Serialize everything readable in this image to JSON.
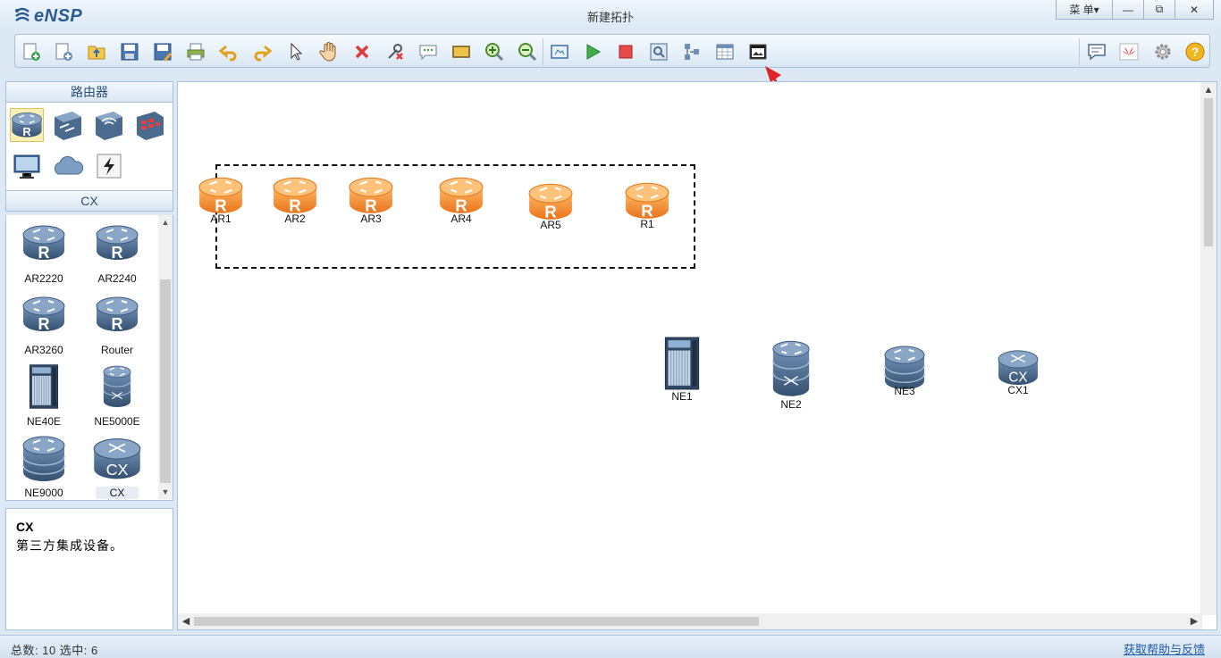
{
  "app": {
    "name": "eNSP",
    "window_title": "新建拓扑"
  },
  "window_controls": {
    "menu": "菜 单▾",
    "minimize": "—",
    "restore": "⧉",
    "close": "✕"
  },
  "toolbar": {
    "icons": [
      "new-topology-icon",
      "new-page-icon",
      "open-icon",
      "save-icon",
      "save-as-icon",
      "print-icon",
      "undo-icon",
      "redo-icon",
      "select-icon",
      "hand-icon",
      "delete-icon",
      "delete-link-icon",
      "text-icon",
      "rectangle-icon",
      "zoom-in-icon",
      "zoom-out-icon",
      "fit-icon",
      "start-icon",
      "stop-icon",
      "capture-icon",
      "topology-icon",
      "grid-icon",
      "console-icon"
    ],
    "right_icons": [
      "message-icon",
      "huawei-icon",
      "settings-icon",
      "help-icon"
    ]
  },
  "sidebar": {
    "category_header": "路由器",
    "categories": [
      "router-category-icon",
      "switch-category-icon",
      "wlan-category-icon",
      "firewall-category-icon",
      "pc-category-icon",
      "cloud-category-icon",
      "link-category-icon"
    ],
    "device_header": "CX",
    "devices": [
      {
        "label": "AR2220",
        "icon": "ar2220-icon"
      },
      {
        "label": "AR2240",
        "icon": "ar2240-icon"
      },
      {
        "label": "AR3260",
        "icon": "ar3260-icon"
      },
      {
        "label": "Router",
        "icon": "router-icon"
      },
      {
        "label": "NE40E",
        "icon": "ne40e-icon"
      },
      {
        "label": "NE5000E",
        "icon": "ne5000e-icon"
      },
      {
        "label": "NE9000",
        "icon": "ne9000-icon"
      },
      {
        "label": "CX",
        "icon": "cx-icon"
      }
    ],
    "info": {
      "title": "CX",
      "description": "第三方集成设备。"
    }
  },
  "canvas": {
    "nodes": [
      {
        "label": "AR1",
        "kind": "orange-router"
      },
      {
        "label": "AR2",
        "kind": "orange-router"
      },
      {
        "label": "AR3",
        "kind": "orange-router"
      },
      {
        "label": "AR4",
        "kind": "orange-router"
      },
      {
        "label": "AR5",
        "kind": "orange-router"
      },
      {
        "label": "R1",
        "kind": "orange-router"
      },
      {
        "label": "NE1",
        "kind": "chassis"
      },
      {
        "label": "NE2",
        "kind": "tall-router"
      },
      {
        "label": "NE3",
        "kind": "stack-router"
      },
      {
        "label": "CX1",
        "kind": "cx-router"
      }
    ]
  },
  "status": {
    "text": "总数: 10  选中: 6",
    "help_link": "获取帮助与反馈"
  },
  "colors": {
    "accent": "#2a5b93",
    "selected_router": "#f08a28",
    "device_blue": "#4a6a8e",
    "annotation_arrow": "#e0232b"
  }
}
